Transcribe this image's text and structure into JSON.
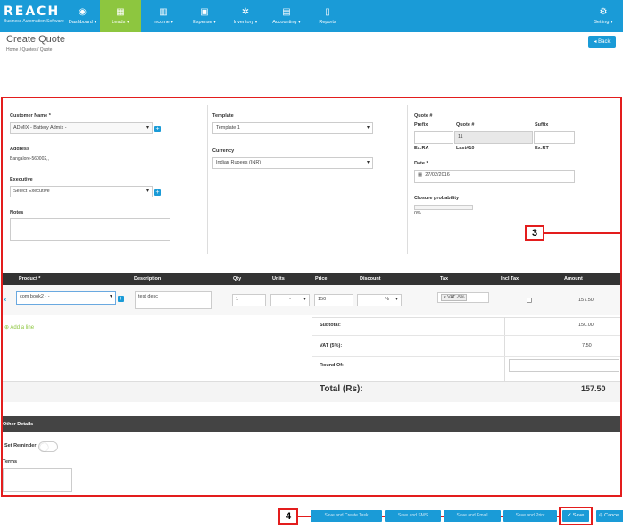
{
  "app": {
    "brand": "REACH",
    "tagline": "Business Automation Software"
  },
  "nav": [
    {
      "label": "Dashboard ▾",
      "icon": "dashboard-icon",
      "glyph": "◉"
    },
    {
      "label": "Leads ▾",
      "icon": "leads-icon",
      "glyph": "▦"
    },
    {
      "label": "Income ▾",
      "icon": "income-icon",
      "glyph": "▥"
    },
    {
      "label": "Expense ▾",
      "icon": "expense-icon",
      "glyph": "▣"
    },
    {
      "label": "Inventory ▾",
      "icon": "inventory-icon",
      "glyph": "✲"
    },
    {
      "label": "Accounting ▾",
      "icon": "accounting-icon",
      "glyph": "▤"
    },
    {
      "label": "Reports",
      "icon": "reports-icon",
      "glyph": "▯"
    },
    {
      "label": "Setting ▾",
      "icon": "gear-icon",
      "glyph": "⚙"
    }
  ],
  "header": {
    "title": "Create Quote",
    "breadcrumb": "Home  /  Quotes  /  Quote",
    "back_label": "◂ Back"
  },
  "form": {
    "customer_label": "Customer Name *",
    "customer_value": "ADMIX - Battery Admix -",
    "address_label": "Address",
    "address_value": "Bangalore-560002,,",
    "executive_label": "Executive",
    "executive_value": "Select Executive",
    "notes_label": "Notes",
    "template_label": "Template",
    "template_value": "Template 1",
    "currency_label": "Currency",
    "currency_value": "Indian Rupees (INR)",
    "quote_no_label": "Quote #",
    "prefix_label": "Prefix",
    "quote_col_label": "Quote #",
    "suffix_label": "Suffix",
    "quote_no_value": "11",
    "prefix_example": "Ex:RA",
    "last_no": "Last#10",
    "suffix_example": "Ex:RT",
    "date_label": "Date *",
    "date_value": "27/02/2016",
    "closure_label": "Closure probability",
    "closure_value": "0%",
    "closure_fraction": 0
  },
  "table": {
    "headers": [
      "Product *",
      "Description",
      "Qty",
      "Units",
      "Price",
      "Discount",
      "Tax",
      "Incl Tax",
      "Amount"
    ],
    "row": {
      "remove": "x",
      "product": "com book2 - -",
      "description": "test desc",
      "qty": "1",
      "units": "-",
      "price": "150",
      "discount": "%",
      "tax": "× VAT -5%",
      "amount": "157.50"
    },
    "add_line": "⊕ Add a line"
  },
  "totals": {
    "subtotal_label": "Subtotal:",
    "subtotal_value": "150.00",
    "vat_label": "VAT (5%):",
    "vat_value": "7.50",
    "round_label": "Round Of:",
    "total_label": "Total (Rs):",
    "total_value": "157.50"
  },
  "other": {
    "heading": "Other Details",
    "reminder_label": "Set Reminder",
    "terms_label": "Terms"
  },
  "annotations": {
    "box3": "3",
    "box4": "4"
  },
  "footer": {
    "buttons": [
      "Save and Create Task",
      "Save and SMS",
      "Save and Email",
      "Save and Print"
    ],
    "save_label": "✔ Save",
    "cancel_label": "⊘ Cancel"
  },
  "colors": {
    "primary": "#1a9bd7",
    "active_nav": "#8dc63f",
    "annotation": "#e31d1d",
    "table_header": "#333333"
  }
}
